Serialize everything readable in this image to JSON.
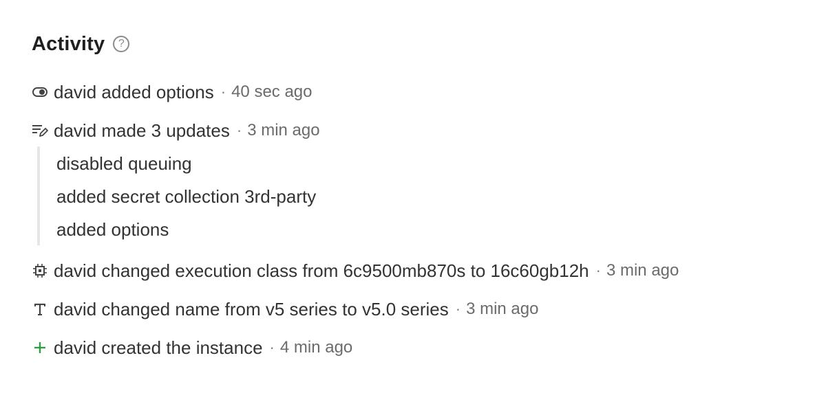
{
  "activity": {
    "title": "Activity",
    "help_icon": "question-circle-icon",
    "items": [
      {
        "icon": "toggle-icon",
        "text": "david added options",
        "separator": "·",
        "time": "40 sec ago"
      },
      {
        "icon": "list-edit-icon",
        "text": "david made 3 updates",
        "separator": "·",
        "time": "3 min ago",
        "sub_items": [
          "disabled queuing",
          "added secret collection 3rd-party",
          "added options"
        ]
      },
      {
        "icon": "cpu-chip-icon",
        "text": "david changed execution class from 6c9500mb870s to 16c60gb12h",
        "separator": "·",
        "time": "3 min ago"
      },
      {
        "icon": "text-type-icon",
        "text": "david changed name from v5 series to v5.0 series",
        "separator": "·",
        "time": "3 min ago"
      },
      {
        "icon": "plus-icon",
        "text": "david created the instance",
        "separator": "·",
        "time": "4 min ago"
      }
    ]
  },
  "colors": {
    "text": "#333333",
    "muted": "#6b6b6b",
    "plus": "#2e9e3e",
    "rail": "#e6e6e6"
  }
}
